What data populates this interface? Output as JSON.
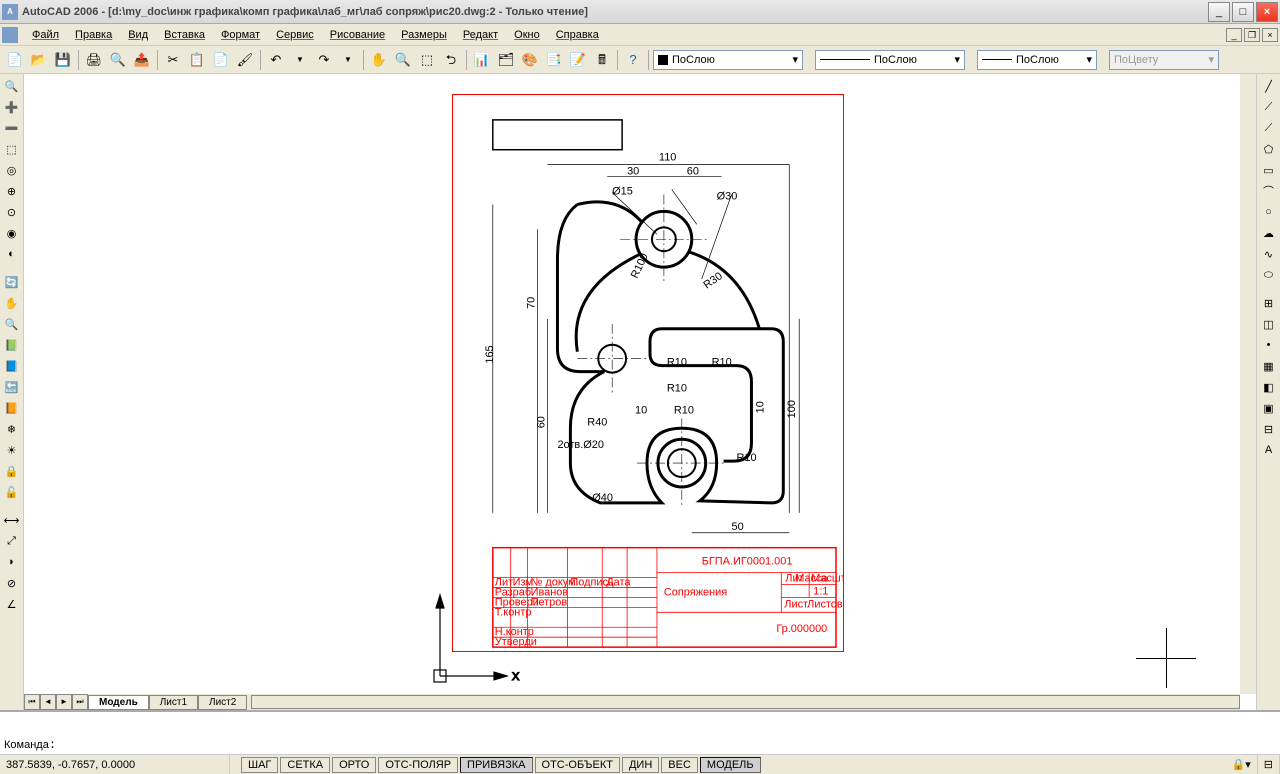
{
  "title": "AutoCAD 2006 - [d:\\my_doc\\инж графика\\комп графика\\лаб_мг\\лаб сопряж\\рис20.dwg:2 - Только чтение]",
  "menu": [
    "Файл",
    "Правка",
    "Вид",
    "Вставка",
    "Формат",
    "Сервис",
    "Рисование",
    "Размеры",
    "Редакт",
    "Окно",
    "Справка"
  ],
  "layer_select": "ПоСлою",
  "linetype_select": "ПоСлою",
  "lineweight_select": "ПоСлою",
  "color_select": "ПоЦвету",
  "tabs": {
    "items": [
      "Модель",
      "Лист1",
      "Лист2"
    ],
    "active": 0
  },
  "cmd_label": "Команда",
  "status_coords": "387.5839, -0.7657, 0.0000",
  "status_btns": [
    "ШАГ",
    "СЕТКА",
    "ОРТО",
    "ОТС-ПОЛЯР",
    "ПРИВЯЗКА",
    "ОТС-ОБЪЕКТ",
    "ДИН",
    "ВЕС",
    "МОДЕЛЬ"
  ],
  "status_active": [
    4,
    8
  ],
  "drawing": {
    "dims": {
      "d110": "110",
      "d30": "30",
      "d60": "60",
      "d70": "70",
      "d165": "165",
      "d60b": "60",
      "d50": "50",
      "d100": "100",
      "d10": "10",
      "dia15": "Ø15",
      "dia30": "Ø30",
      "dia40": "Ø40",
      "holes": "2отв.Ø20",
      "r30": "R30",
      "r40": "R40",
      "r100": "R100",
      "r10a": "R10",
      "r10b": "R10",
      "r10c": "R10",
      "r10d": "R10",
      "r10e": "R10",
      "r10": "10"
    },
    "titleblock": {
      "code": "БГПА.ИГ0001.001",
      "name": "Сопряжения",
      "scale": "1:1",
      "group": "Гр.000000",
      "rows": [
        "Разраб",
        "Провери",
        "Т.контр",
        "Н.контр",
        "Утверди"
      ],
      "names": [
        "Иванов",
        "Петров"
      ],
      "hdr": [
        "Лит",
        "Масса",
        "Масшт."
      ],
      "sheet": "Лист",
      "sheets": "Листов 1",
      "colh": [
        "Лит",
        "Изм",
        "№ докум.",
        "Подпись",
        "Дата"
      ]
    }
  }
}
